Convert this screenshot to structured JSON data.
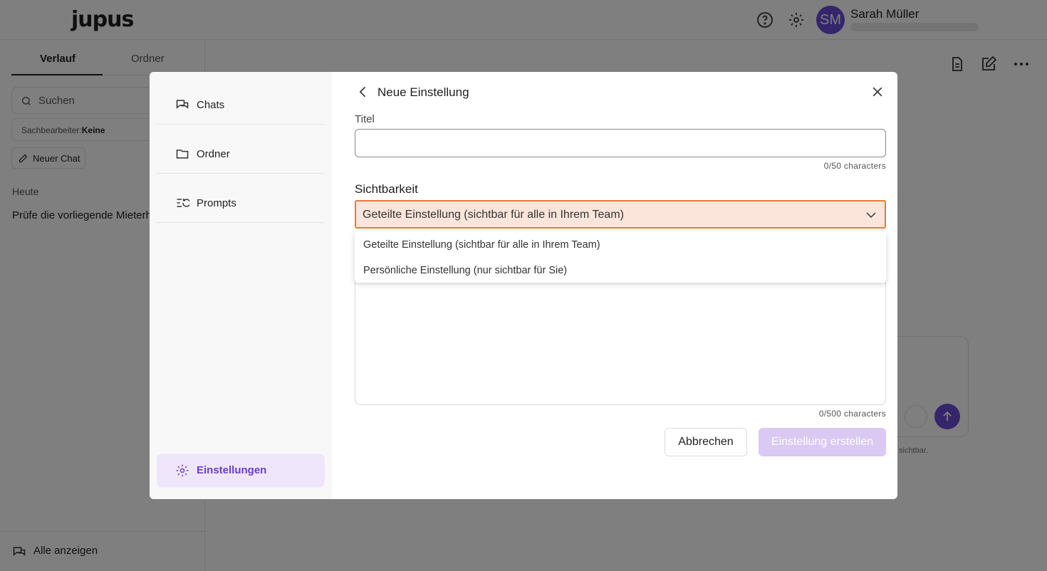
{
  "app": {
    "logo": "jupus",
    "user_initials": "SM",
    "user_name": "Sarah Müller"
  },
  "history_panel": {
    "tabs": [
      {
        "label": "Verlauf"
      },
      {
        "label": "Ordner"
      }
    ],
    "search_placeholder": "Suchen",
    "filter_label": "Sachbearbeiter:",
    "filter_value": "Keine",
    "new_chat": "Neuer Chat",
    "section_heading": "Heute",
    "items": [
      {
        "label": "Prüfe die vorliegende Mieterh"
      }
    ],
    "show_all": "Alle anzeigen"
  },
  "chat": {
    "hint_partial": "sichtbar."
  },
  "modal": {
    "nav": [
      {
        "label": "Chats",
        "icon": "chats-icon"
      },
      {
        "label": "Ordner",
        "icon": "folder-icon"
      },
      {
        "label": "Prompts",
        "icon": "prompts-icon"
      }
    ],
    "nav_active": {
      "label": "Einstellungen",
      "icon": "gear-icon"
    },
    "title": "Neue Einstellung",
    "form": {
      "title_label": "Titel",
      "title_value": "",
      "title_count": "0/50 characters",
      "visibility_label": "Sichtbarkeit",
      "visibility_selected": "Geteilte Einstellung (sichtbar für alle in Ihrem Team)",
      "visibility_options": [
        {
          "label": "Geteilte Einstellung (sichtbar für alle in Ihrem Team)"
        },
        {
          "label": "Persönliche Einstellung (nur sichtbar für Sie)"
        }
      ],
      "description_count": "0/500 characters"
    },
    "cancel_label": "Abbrechen",
    "create_label": "Einstellung erstellen"
  },
  "colors": {
    "accent": "#6a4bd6",
    "select_border": "#e8793b",
    "select_bg": "#fbe5da",
    "nav_active_bg": "#f0e6fb",
    "create_disabled": "#d9c9f3"
  }
}
